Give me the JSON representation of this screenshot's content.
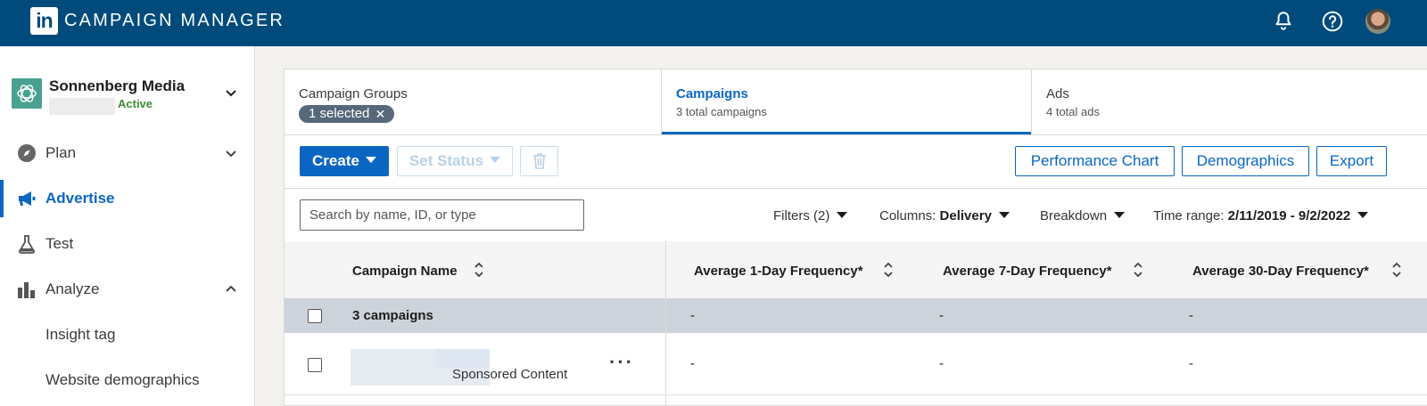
{
  "header": {
    "logo_text": "in",
    "app_title": "CAMPAIGN MANAGER",
    "icons": [
      "bell-icon",
      "help-icon",
      "avatar"
    ]
  },
  "sidebar": {
    "account": {
      "name": "Sonnenberg Media",
      "status": "Active"
    },
    "nav": [
      {
        "label": "Plan",
        "icon": "compass-icon",
        "expanded": false
      },
      {
        "label": "Advertise",
        "icon": "megaphone-icon",
        "active": true
      },
      {
        "label": "Test",
        "icon": "flask-icon"
      },
      {
        "label": "Analyze",
        "icon": "bar-chart-icon",
        "expanded": true
      }
    ],
    "analyze_items": [
      "Insight tag",
      "Website demographics"
    ]
  },
  "tabs": [
    {
      "title": "Campaign Groups",
      "chip": "1 selected"
    },
    {
      "title": "Campaigns",
      "subtitle": "3 total campaigns",
      "active": true
    },
    {
      "title": "Ads",
      "subtitle": "4 total ads"
    }
  ],
  "toolbar": {
    "create_label": "Create",
    "set_status_label": "Set Status",
    "performance_chart_label": "Performance Chart",
    "demographics_label": "Demographics",
    "export_label": "Export"
  },
  "filters": {
    "search_placeholder": "Search by name, ID, or type",
    "filters_label": "Filters (2)",
    "columns_label": "Columns:",
    "columns_value": "Delivery",
    "breakdown_label": "Breakdown",
    "time_range_label": "Time range:",
    "time_range_value": "2/11/2019 - 9/2/2022"
  },
  "table": {
    "columns": [
      "Campaign Name",
      "Average 1-Day Frequency*",
      "Average 7-Day Frequency*",
      "Average 30-Day Frequency*"
    ],
    "summary": {
      "name": "3 campaigns",
      "values": [
        "-",
        "-",
        "-"
      ]
    },
    "rows": [
      {
        "type": "Sponsored Content",
        "values": [
          "-",
          "-",
          "-"
        ]
      }
    ]
  },
  "colors": {
    "header_bg": "#004b7c",
    "accent": "#0a66c2",
    "active_status": "#3d8a35",
    "summary_row_bg": "#cdd3da"
  }
}
